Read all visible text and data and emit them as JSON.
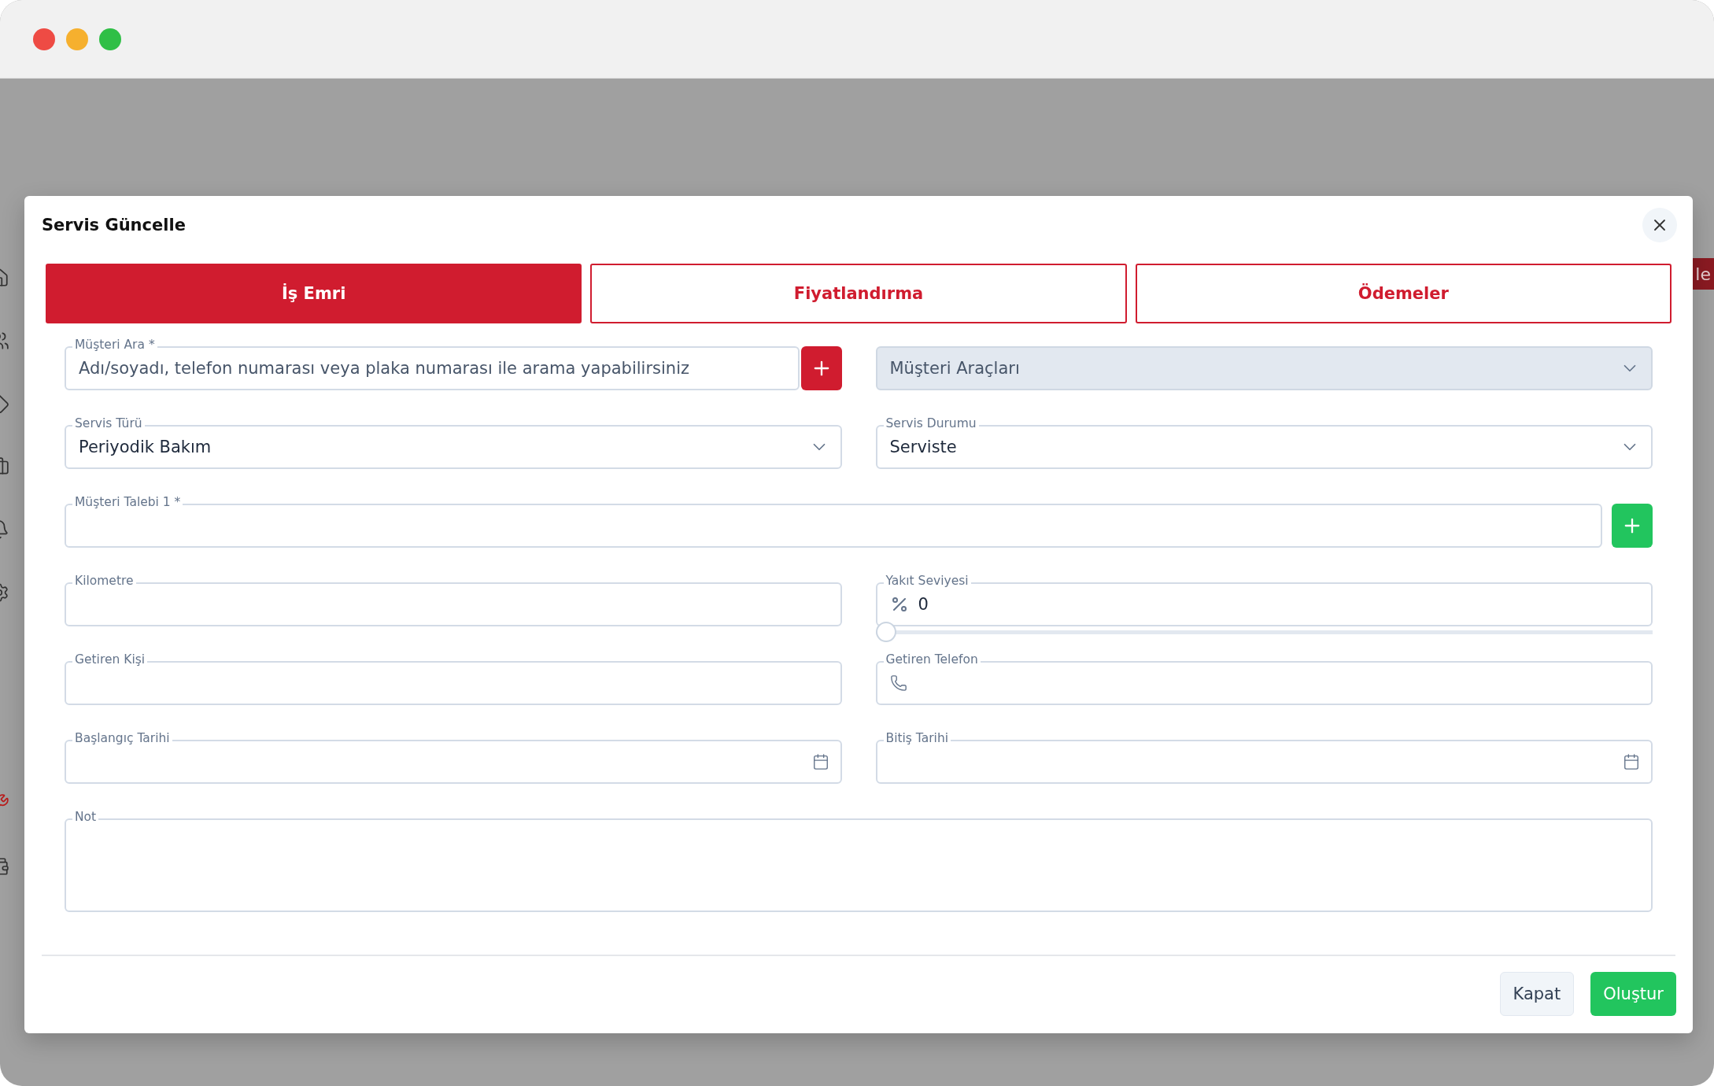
{
  "background": {
    "button_text": "le"
  },
  "dialog": {
    "title": "Servis Güncelle",
    "tabs": [
      {
        "label": "İş Emri",
        "selected": true
      },
      {
        "label": "Fiyatlandırma",
        "selected": false
      },
      {
        "label": "Ödemeler",
        "selected": false
      }
    ],
    "fields": [
      {
        "kind": "search",
        "label": "Müşteri Ara *",
        "placeholder": "Adı/soyadı, telefon numarası veya plaka numarası ile arama yapabilirsiniz"
      },
      {
        "kind": "select",
        "placeholder": "Müşteri Araçları",
        "disabled": true
      },
      {
        "kind": "select",
        "label": "Servis Türü",
        "value": "Periyodik Bakım",
        "disabled": false
      },
      {
        "kind": "select",
        "label": "Servis Durumu",
        "value": "Serviste",
        "disabled": false
      },
      {
        "kind": "request",
        "label": "Müşteri Talebi 1 *"
      },
      {
        "kind": "text",
        "label": "Kilometre"
      },
      {
        "kind": "fuel",
        "label": "Yakıt Seviyesi",
        "value": "0",
        "level": 0
      },
      {
        "kind": "text",
        "label": "Getiren Kişi"
      },
      {
        "kind": "phone",
        "label": "Getiren Telefon"
      },
      {
        "kind": "date",
        "label": "Başlangıç Tarihi"
      },
      {
        "kind": "date",
        "label": "Bitiş Tarihi"
      },
      {
        "kind": "note",
        "label": "Not"
      }
    ],
    "buttons": [
      {
        "label": "Kapat",
        "kind": "secondary"
      },
      {
        "label": "Oluştur",
        "kind": "primary"
      }
    ]
  }
}
